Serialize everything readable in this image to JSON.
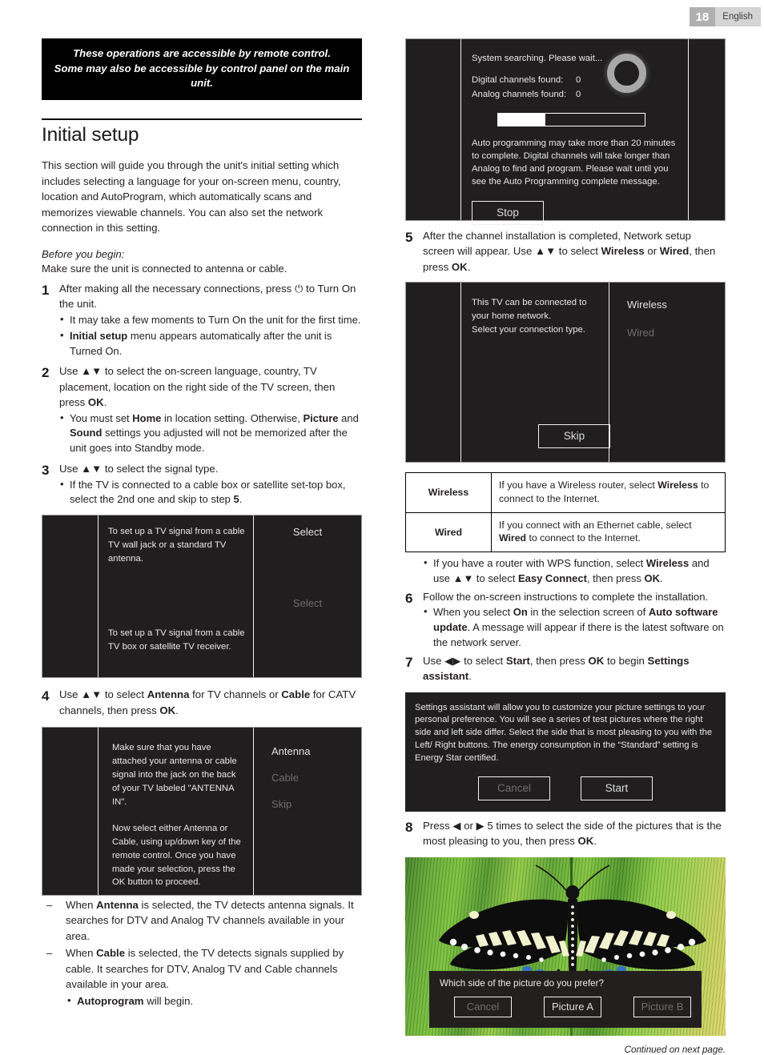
{
  "header": {
    "page_number": "18",
    "language": "English"
  },
  "banner": {
    "line1": "These operations are accessible by remote control.",
    "line2": "Some may also be accessible by control panel on the main unit."
  },
  "section": {
    "title": "Initial setup",
    "intro": "This section will guide you through the unit's initial setting which includes selecting a language for your on-screen menu, country, location and AutoProgram, which automatically scans and memorizes viewable channels. You can also set the network connection in this setting.",
    "before_you_begin_heading": "Before you begin:",
    "before_you_begin_text": "Make sure the unit is connected to antenna or cable."
  },
  "steps": {
    "s1": {
      "num": "1",
      "text_a": "After making all the necessary connections, press ",
      "power_icon": "⏻",
      "text_b": " to Turn On the unit.",
      "b1": "It may take a few moments to Turn On the unit for the first time.",
      "b2_bold": "Initial setup",
      "b2_rest": " menu appears automatically after the unit is Turned On."
    },
    "s2": {
      "num": "2",
      "text_a": "Use ",
      "arrows": "▲▼",
      "text_b": " to select the on-screen language, country, TV placement, location on the right side of the TV screen, then press ",
      "ok": "OK",
      "text_c": ".",
      "b1_a": "You must set ",
      "b1_home": "Home",
      "b1_b": " in location setting. Otherwise, ",
      "b1_picture": "Picture",
      "b1_c": " and ",
      "b1_sound": "Sound",
      "b1_d": " settings you adjusted will not be memorized after the unit goes into Standby mode."
    },
    "s3": {
      "num": "3",
      "text_a": "Use ",
      "arrows": "▲▼",
      "text_b": " to select the signal type.",
      "b1_a": "If the TV is connected to a cable box or satellite set-top box, select the 2nd one and skip to step ",
      "b1_num": "5",
      "b1_b": "."
    },
    "s4": {
      "num": "4",
      "text_a": "Use ",
      "arrows": "▲▼",
      "text_b": " to select ",
      "antenna": "Antenna",
      "text_c": " for TV channels or ",
      "cable": "Cable",
      "text_d": " for CATV channels, then press ",
      "ok": "OK",
      "text_e": "."
    },
    "s5": {
      "num": "5",
      "text_a": "After the channel installation is completed, Network setup screen will appear. Use ",
      "arrows": "▲▼",
      "text_b": " to select ",
      "wireless": "Wireless",
      "text_c": " or ",
      "wired": "Wired",
      "text_d": ", then press ",
      "ok": "OK",
      "text_e": "."
    },
    "s6": {
      "num": "6",
      "text": "Follow the on-screen instructions to complete the installation.",
      "b1_a": "When you select ",
      "b1_on": "On",
      "b1_b": " in the selection screen of ",
      "b1_auto": "Auto software update",
      "b1_c": ". A message will appear if there is the latest software on the network server."
    },
    "s7": {
      "num": "7",
      "text_a": "Use ",
      "arrows": "◀▶",
      "text_b": " to select ",
      "start": "Start",
      "text_c": ", then press ",
      "ok": "OK",
      "text_d": " to begin ",
      "assistant": "Settings assistant",
      "text_e": "."
    },
    "s8": {
      "num": "8",
      "text_a": "Press ",
      "left_arrow": "◀",
      "text_b": " or ",
      "right_arrow": "▶",
      "text_c": " 5 times to select the side of the pictures that is the most pleasing to you, then press ",
      "ok": "OK",
      "text_d": "."
    }
  },
  "dash_notes": {
    "n1_a": "When ",
    "n1_antenna": "Antenna",
    "n1_b": " is selected, the TV detects antenna signals. It searches for DTV and Analog TV channels available in your area.",
    "n2_a": "When ",
    "n2_cable": "Cable",
    "n2_b": " is selected, the TV detects signals supplied by cable. It searches for DTV, Analog TV and Cable channels available in your area.",
    "n2_sub_bold": "Autoprogram",
    "n2_sub_rest": " will begin."
  },
  "screens": {
    "signal_type": {
      "row1_text": "To set up a TV signal from a cable TV wall jack or a standard TV antenna.",
      "row1_action": "Select",
      "row2_text": "To set up a TV signal from a cable TV box or satellite TV receiver.",
      "row2_action": "Select"
    },
    "antenna_cable": {
      "para1": "Make sure that you have attached your antenna or cable signal into the jack on the back of your TV labeled \"ANTENNA IN\".",
      "para2": "Now select either Antenna or Cable, using up/down key of the remote control. Once you have made your selection, press the OK button to proceed.",
      "options": [
        "Antenna",
        "Cable",
        "Skip"
      ]
    },
    "searching": {
      "title": "System searching. Please wait...",
      "rows": [
        {
          "label": "Digital channels found:",
          "value": "0"
        },
        {
          "label": "Analog channels found:",
          "value": "0"
        }
      ],
      "progress_percent": 32,
      "note": "Auto programming may take more than 20 minutes to complete. Digital channels will take longer than Analog to find and program. Please wait until you see the Auto Programming complete message.",
      "stop_label": "Stop"
    },
    "network": {
      "line1": "This TV can be connected to",
      "line2": "your home network.",
      "line3": "Select your connection type.",
      "options": [
        "Wireless",
        "Wired"
      ],
      "skip_label": "Skip"
    },
    "settings_assistant": {
      "text": "Settings assistant will allow you to customize your picture settings to your personal preference. You will see a series of test pictures where the right side and left side differ. Select the side that is most pleasing to you with the Left/ Right buttons. The energy consumption in the “Standard” setting is Energy Star certified.",
      "cancel_label": "Cancel",
      "start_label": "Start"
    },
    "picture_choice": {
      "question": "Which side of the picture do you prefer?",
      "cancel_label": "Cancel",
      "picture_a_label": "Picture A",
      "picture_b_label": "Picture B"
    }
  },
  "network_table": {
    "rows": [
      {
        "key": "Wireless",
        "desc_a": "If you have a Wireless router, select ",
        "desc_bold": "Wireless",
        "desc_b": " to connect to the Internet."
      },
      {
        "key": "Wired",
        "desc_a": "If you connect with an Ethernet cable, select ",
        "desc_bold": "Wired",
        "desc_b": " to connect to the Internet."
      }
    ],
    "wps_bullet": {
      "a": "If you have a router with WPS function, select ",
      "wireless": "Wireless",
      "b": " and use ",
      "arrows": "▲▼",
      "c": " to select ",
      "easy": "Easy Connect",
      "d": ", then press ",
      "ok": "OK",
      "e": "."
    }
  },
  "footer": {
    "continued": "Continued on next page."
  }
}
